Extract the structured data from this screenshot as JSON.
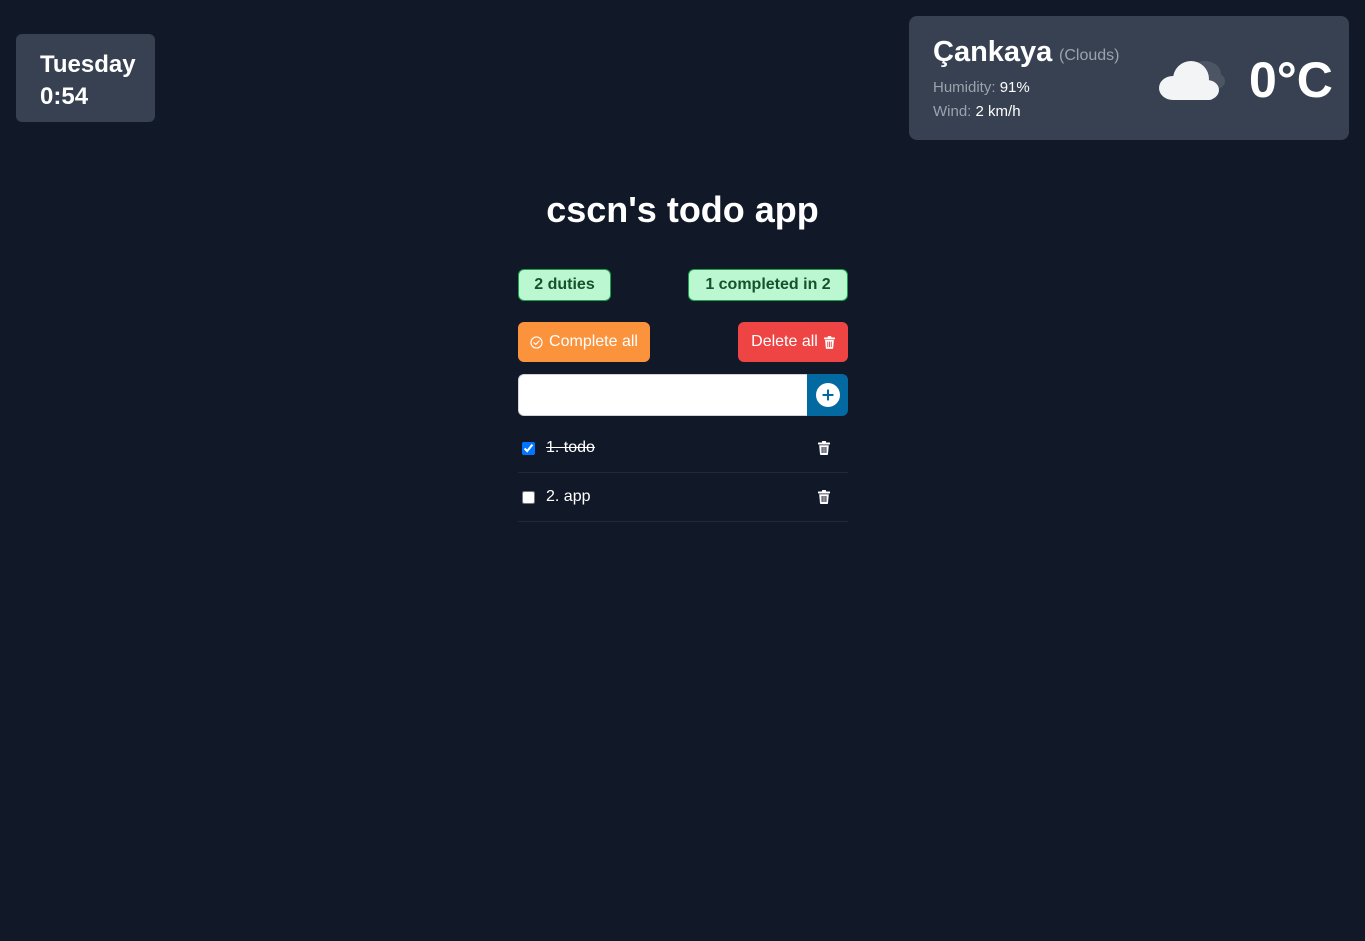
{
  "clock": {
    "day": "Tuesday",
    "time": "0:54"
  },
  "weather": {
    "city": "Çankaya",
    "condition": "(Clouds)",
    "humidity_label": "Humidity:",
    "humidity_value": "91%",
    "wind_label": "Wind:",
    "wind_value": "2 km/h",
    "temperature": "0°C",
    "icon": "cloud-icon"
  },
  "app": {
    "title": "cscn's todo app"
  },
  "stats": {
    "duties": "2 duties",
    "completed": "1 completed in 2"
  },
  "actions": {
    "complete_all": "Complete all",
    "delete_all": "Delete all"
  },
  "input": {
    "value": "",
    "placeholder": ""
  },
  "todos": [
    {
      "text": "1. todo",
      "completed": true
    },
    {
      "text": "2. app",
      "completed": false
    }
  ],
  "colors": {
    "background": "#111827",
    "card": "#374151",
    "badge_bg": "#bbf7d0",
    "badge_text": "#14532d",
    "complete_button": "#fb923c",
    "delete_button": "#ef4444",
    "add_button": "#0369a1"
  }
}
